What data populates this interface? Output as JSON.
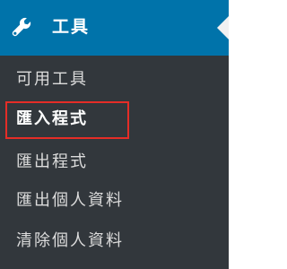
{
  "menu": {
    "header": {
      "label": "工具",
      "icon": "wrench-icon"
    },
    "items": [
      {
        "label": "可用工具",
        "selected": false
      },
      {
        "label": "匯入程式",
        "selected": true
      },
      {
        "label": "匯出程式",
        "selected": false
      },
      {
        "label": "匯出個人資料",
        "selected": false
      },
      {
        "label": "清除個人資料",
        "selected": false
      }
    ]
  },
  "colors": {
    "header_background": "#0073aa",
    "submenu_background": "#32373c",
    "highlight_border": "#e52d27",
    "active_text": "#ffffff",
    "inactive_text": "#dcdcdc"
  }
}
